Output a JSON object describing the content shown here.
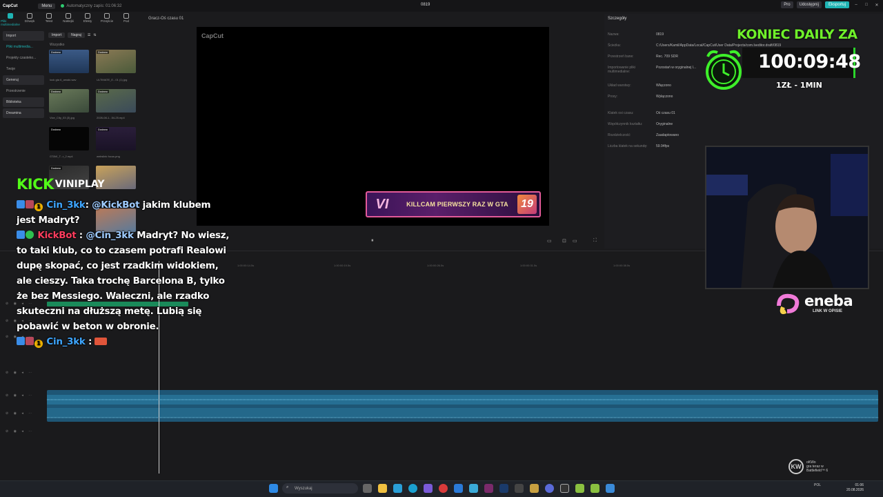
{
  "titlebar": {
    "app": "CapCut",
    "menu": "Menu",
    "autosave": "Automatyczny zapis: 01:06:32",
    "project": "0819",
    "pro": "Pro",
    "share": "Udostępnij",
    "export": "Eksportuj"
  },
  "tools": [
    "Pliki multimedialne",
    "Dźwięk",
    "Tekst",
    "Naklejki",
    "Efekty",
    "Przejście",
    "Pod"
  ],
  "sidebar": [
    "Import",
    "Pliki multimedia...",
    "Projekty czasteko...",
    "Twoje",
    "Generuj",
    "Przestrzenie",
    "Biblioteka",
    "Dreamina"
  ],
  "media": {
    "import": "Import",
    "zapisz": "Nagraj",
    "all": "Wszystko",
    "items": [
      {
        "tag": "Dodano",
        "dur": "00:13",
        "label": "look gta 6_amaki.wav"
      },
      {
        "tag": "Dodano",
        "dur": "",
        "label": "ULTIMATE_E...01 (1).jpg"
      },
      {
        "tag": "Dodano",
        "dur": "",
        "label": "Vice_City_03 (3).jpg"
      },
      {
        "tag": "Dodano",
        "dur": "",
        "label": "2026-08-1...54-25.mp4"
      },
      {
        "tag": "Dodano",
        "dur": "02:47",
        "label": "GTAVI_T...r_2.mp4"
      },
      {
        "tag": "Dodano",
        "dur": "",
        "label": "webslink focus.png"
      },
      {
        "tag": "Dodano",
        "dur": "",
        "label": "vice_racing.png"
      },
      {
        "tag": "",
        "dur": "",
        "label": "ULTIMATE_E...01 (2).jpg"
      }
    ]
  },
  "player": {
    "header": "Gracz-Oś czasu 01",
    "watermark": "CapCut",
    "banner_logo": "VI",
    "banner_text": "KILLCAM PIERWSZY RAZ W GTA",
    "banner_num": "19"
  },
  "details": {
    "title": "Szczegóły",
    "rows": [
      {
        "label": "Nazwa:",
        "value": "0819"
      },
      {
        "label": "Ścieżka:",
        "value": "C:/Users/Kamil/AppData/Local/CapCut/User Data/Projects/com.lveditor.draft/0819"
      },
      {
        "label": "Przestrzeń barw:",
        "value": "Rec. 709 SDR"
      },
      {
        "label": "Importowanie pliki multimedialne:",
        "value": "Pozostań w oryginalnej l..."
      },
      {
        "label": "Układ warstwy:",
        "value": "Włączono"
      },
      {
        "label": "Proxy:",
        "value": "Wyłączono"
      },
      {
        "label": "Klatek osi czasu:",
        "value": "Oś czasu 01"
      },
      {
        "label": "Współczynnik kształtu:",
        "value": "Oryginalne"
      },
      {
        "label": "Rozdzielczość:",
        "value": "Zaadaptowano"
      },
      {
        "label": "Liczba klatek na sekundę:",
        "value": "59.94fps"
      }
    ]
  },
  "timeline": {
    "ruler": [
      "00:00",
      "1:00:00:14.5s",
      "1:00:00:19.5s",
      "1:00:00:26.5s",
      "1:00:00:31.5s",
      "1:00:00:38.5s"
    ]
  },
  "overlay": {
    "kick": "KICK",
    "channel": "VINIPLAY",
    "koniec": "KONIEC DAILY ZA",
    "timer": "100:09:48",
    "rate": "1ZŁ - 1MIN",
    "eneba": "eneba",
    "eneba_sub": "LINK W OPISIE"
  },
  "chat": [
    {
      "user": "Cin_3kk",
      "text_prefix": ": ",
      "mention": "@KickBot",
      "text": " jakim klubem jest Madryt?"
    },
    {
      "user": "KickBot",
      "text_prefix": " : ",
      "mention": "@Cin_3kk",
      "text": " Madryt? No wiesz, to taki klub, co to czasem potrafi Realowi dupę skopać, co jest rzadkim widokiem, ale cieszy. Taka trochę Barcelona B, tylko że bez Messiego. Waleczni, ale rzadko skuteczni na dłuższą metę. Lubią się pobawić w beton w obronie."
    },
    {
      "user": "Cin_3kk",
      "text_prefix": " : ",
      "mention": "",
      "text": ""
    }
  ],
  "notify": {
    "name": "oKWo",
    "line1": "gra teraz w",
    "line2": "Battlefield™ 6"
  },
  "taskbar": {
    "search": "Wyszukaj",
    "lang": "POL",
    "time": "01:06",
    "date": "20.08.2026"
  }
}
